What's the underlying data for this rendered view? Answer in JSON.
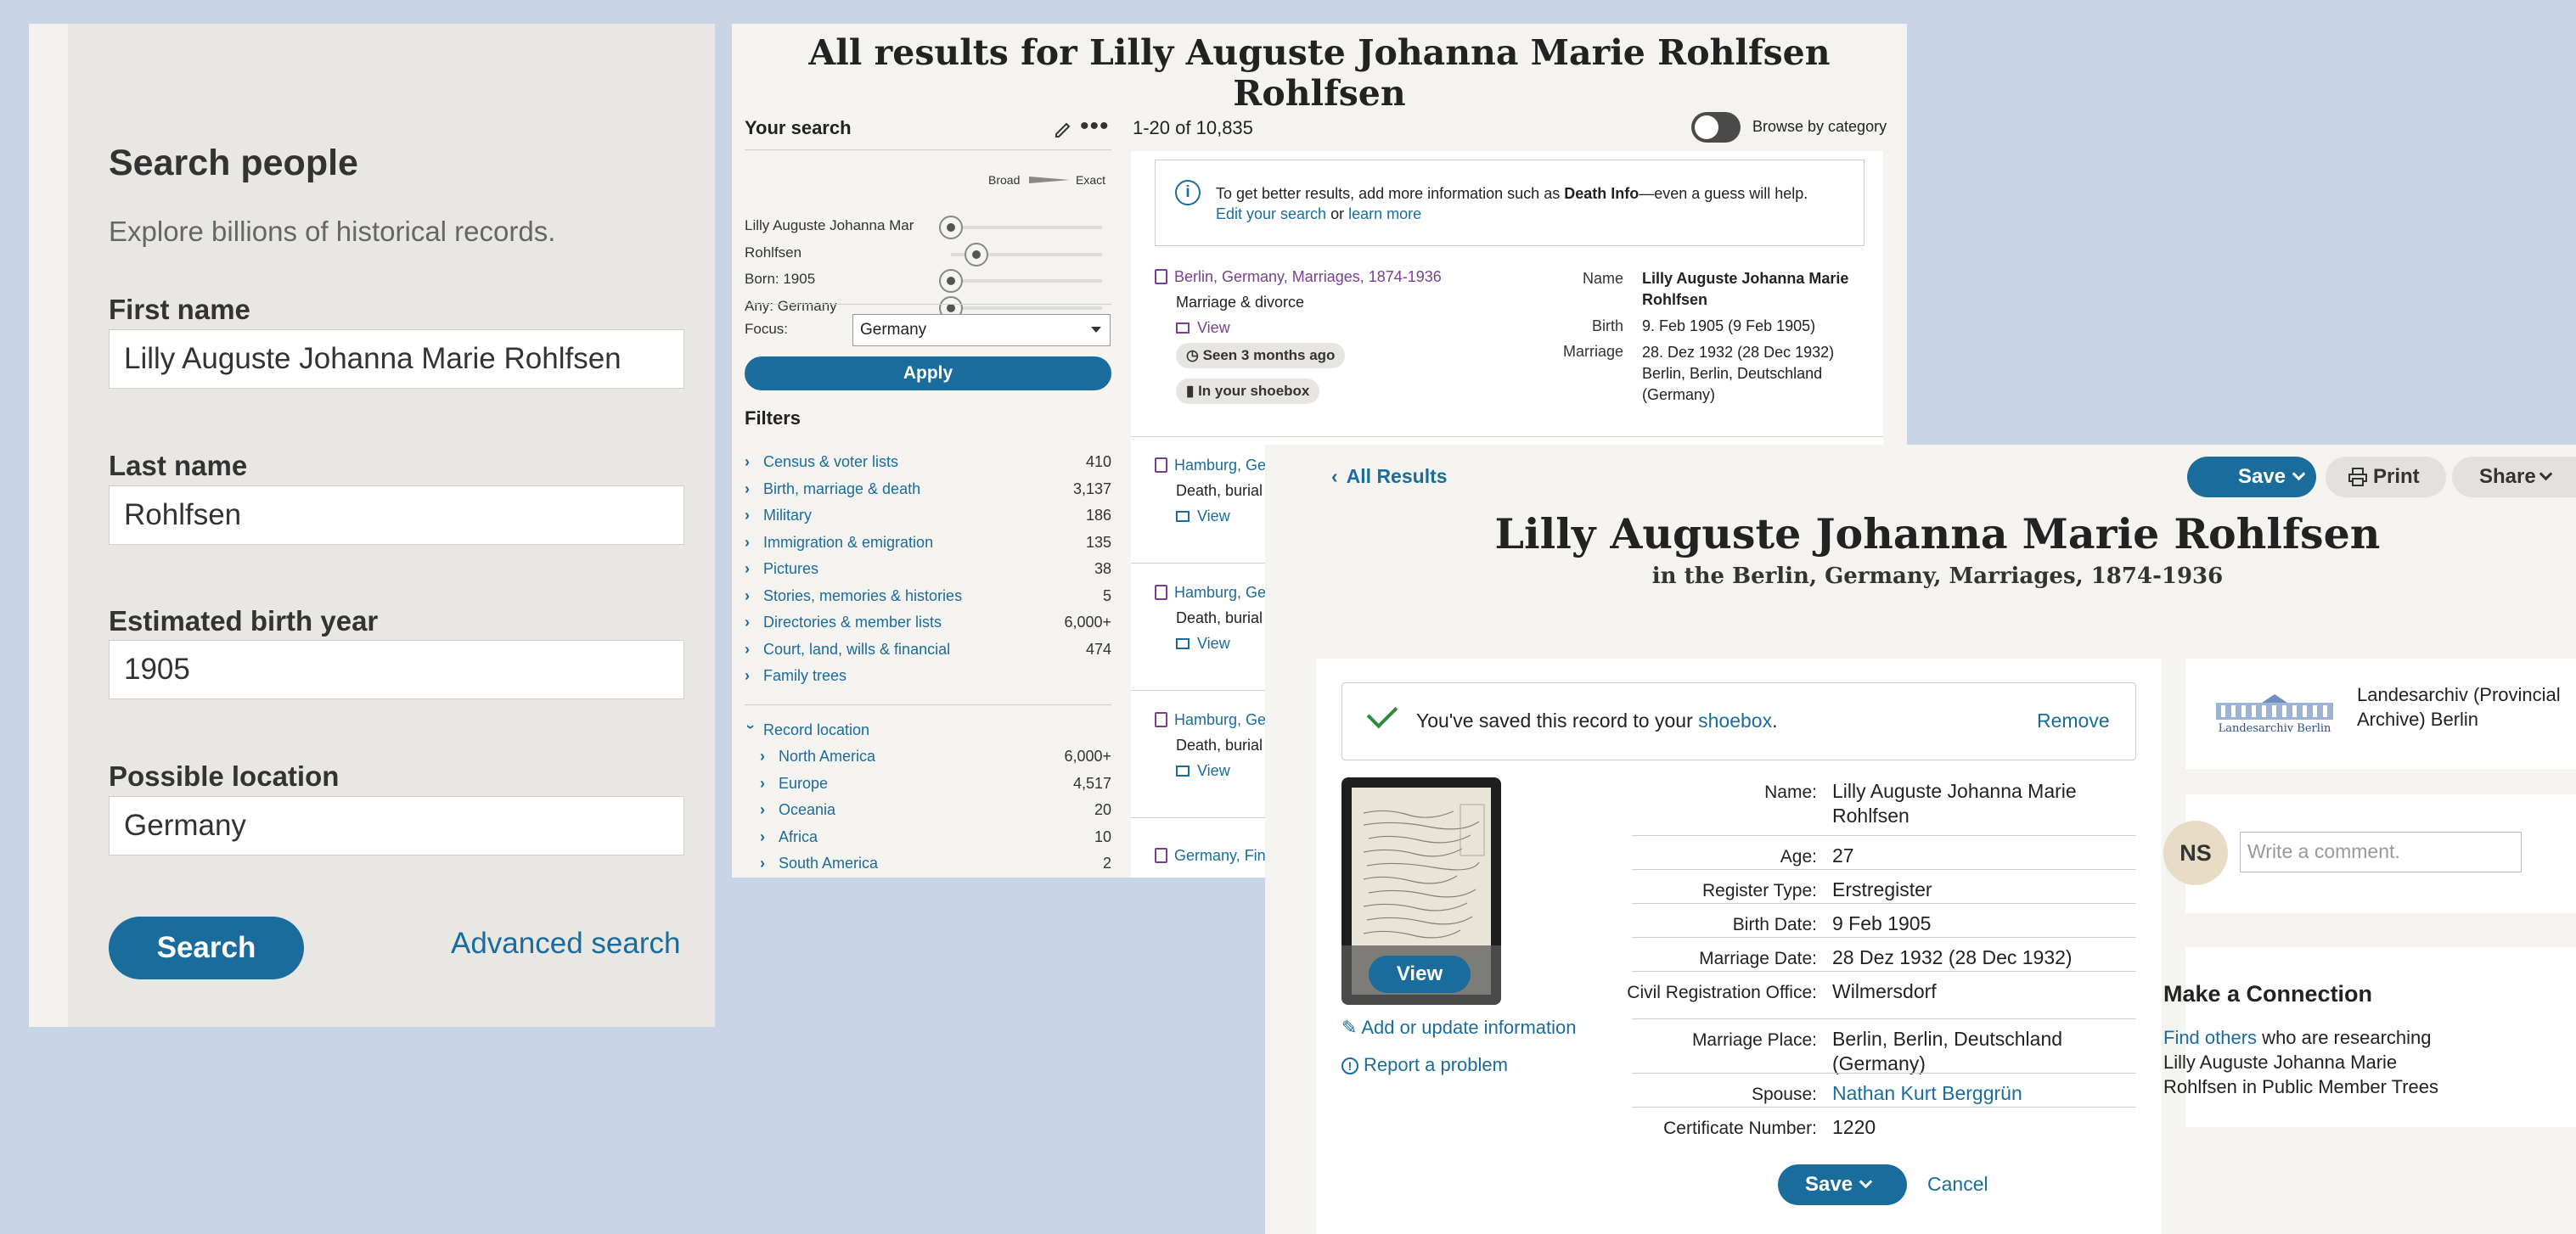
{
  "search_panel": {
    "title": "Search people",
    "subtitle": "Explore billions of historical records.",
    "first_name_label": "First name",
    "first_name_value": "Lilly Auguste Johanna Marie Rohlfsen",
    "last_name_label": "Last name",
    "last_name_value": "Rohlfsen",
    "birth_year_label": "Estimated birth year",
    "birth_year_value": "1905",
    "location_label": "Possible location",
    "location_value": "Germany",
    "search_button": "Search",
    "advanced_link": "Advanced search"
  },
  "results_panel": {
    "title": "All results for Lilly Auguste Johanna Marie Rohlfsen Rohlfsen",
    "your_search": "Your search",
    "broad_label": "Broad",
    "exact_label": "Exact",
    "terms": [
      {
        "label": "Lilly Auguste Johanna Mar",
        "level": 0
      },
      {
        "label": "Rohlfsen",
        "level": 0.17
      },
      {
        "label": "Born: 1905",
        "level": 0
      },
      {
        "label": "Any: Germany",
        "level": 0
      }
    ],
    "focus_label": "Focus:",
    "focus_value": "Germany",
    "apply_button": "Apply",
    "filters_title": "Filters",
    "filters": [
      {
        "name": "Census & voter lists",
        "count": "410"
      },
      {
        "name": "Birth, marriage & death",
        "count": "3,137"
      },
      {
        "name": "Military",
        "count": "186"
      },
      {
        "name": "Immigration & emigration",
        "count": "135"
      },
      {
        "name": "Pictures",
        "count": "38"
      },
      {
        "name": "Stories, memories & histories",
        "count": "5"
      },
      {
        "name": "Directories & member lists",
        "count": "6,000+"
      },
      {
        "name": "Court, land, wills & financial",
        "count": "474"
      },
      {
        "name": "Family trees",
        "count": ""
      }
    ],
    "record_location_label": "Record location",
    "locations": [
      {
        "name": "North America",
        "count": "6,000+"
      },
      {
        "name": "Europe",
        "count": "4,517"
      },
      {
        "name": "Oceania",
        "count": "20"
      },
      {
        "name": "Africa",
        "count": "10"
      },
      {
        "name": "South America",
        "count": "2"
      }
    ],
    "result_count": "1-20 of 10,835",
    "browse_label": "Browse by category",
    "info_text_1": "To get better results, add more information such as ",
    "info_bold": "Death Info",
    "info_text_2": "—even a guess will help.",
    "edit_search_link": "Edit your search",
    "or_text": " or ",
    "learn_more_link": "learn more",
    "first_result": {
      "collection": "Berlin, Germany, Marriages, 1874-1936",
      "category": "Marriage & divorce",
      "view": "View",
      "seen": "Seen 3 months ago",
      "shoebox": "In your shoebox",
      "name_label": "Name",
      "name_value": "Lilly Auguste Johanna Marie Rohlfsen",
      "birth_label": "Birth",
      "birth_value": "9. Feb 1905 (9 Feb 1905)",
      "marriage_label": "Marriage",
      "marriage_value": "28. Dez 1932 (28 Dec 1932) Berlin, Berlin, Deutschland (Germany)"
    },
    "other_results": [
      {
        "collection": "Hamburg, Ge",
        "category": "Death, burial",
        "view": "View"
      },
      {
        "collection": "Hamburg, Ge",
        "category": "Death, burial",
        "view": "View"
      },
      {
        "collection": "Hamburg, Ge",
        "category": "Death, burial",
        "view": "View"
      },
      {
        "collection": "Germany, Fin",
        "category": "",
        "view": ""
      }
    ]
  },
  "record_panel": {
    "back_link": "All Results",
    "save_button": "Save",
    "print_button": "Print",
    "share_button": "Share",
    "person_name": "Lilly Auguste Johanna Marie Rohlfsen",
    "collection_line": "in the Berlin, Germany, Marriages, 1874-1936",
    "saved_text": "You've saved this record to your ",
    "shoebox_link": "shoebox",
    "period": ".",
    "remove_link": "Remove",
    "view_button": "View",
    "add_info_link": "Add or update information",
    "report_link": "Report a problem",
    "details": [
      {
        "key": "Name:",
        "value": "Lilly Auguste Johanna Marie Rohlfsen",
        "link": false
      },
      {
        "key": "Age:",
        "value": "27",
        "link": false
      },
      {
        "key": "Register Type:",
        "value": "Erstregister",
        "link": false
      },
      {
        "key": "Birth Date:",
        "value": "9 Feb 1905",
        "link": false
      },
      {
        "key": "Marriage Date:",
        "value": "28 Dez 1932 (28 Dec 1932)",
        "link": false
      },
      {
        "key": "Civil Registration Office:",
        "value": "Wilmersdorf",
        "link": false
      },
      {
        "key": "Marriage Place:",
        "value": "Berlin, Berlin, Deutschland (Germany)",
        "link": false
      },
      {
        "key": "Spouse:",
        "value": "Nathan Kurt Berggrün",
        "link": true
      },
      {
        "key": "Certificate Number:",
        "value": "1220",
        "link": false
      }
    ],
    "save_bottom": "Save",
    "cancel_link": "Cancel",
    "archive_name": "Landesarchiv (Provincial Archive) Berlin",
    "archive_logo_text": "Landesarchiv Berlin",
    "avatar_initials": "NS",
    "comment_placeholder": "Write a comment.",
    "connection_title": "Make a Connection",
    "find_others_link": "Find others",
    "connection_text": " who are researching Lilly Auguste Johanna Marie Rohlfsen in Public Member Trees"
  }
}
